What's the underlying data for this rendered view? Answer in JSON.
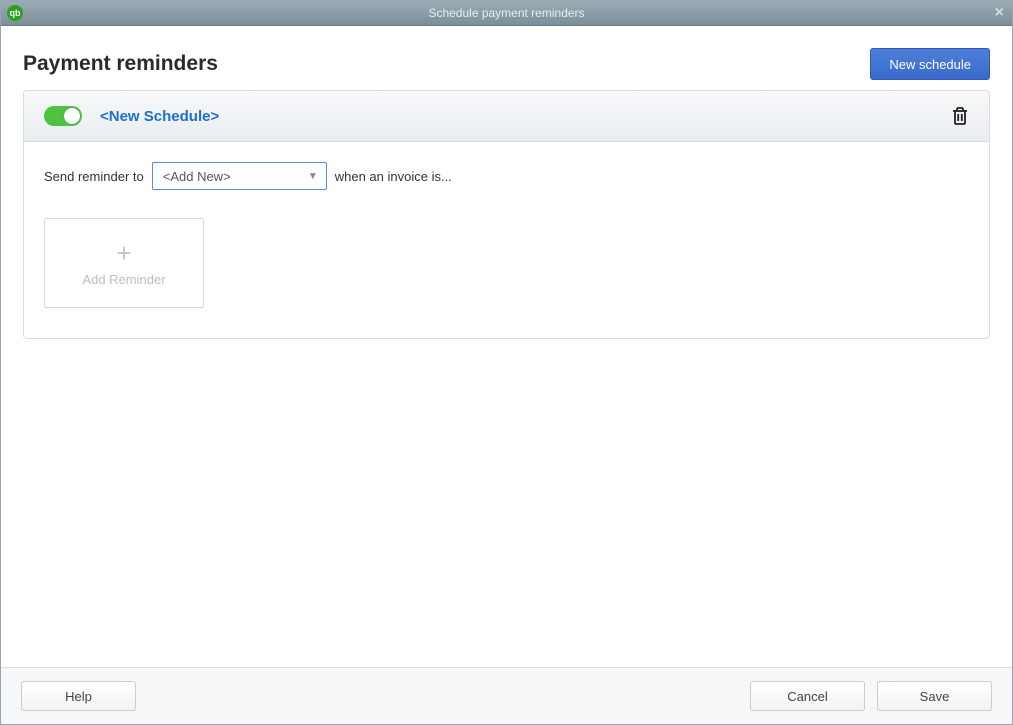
{
  "window": {
    "title": "Schedule payment reminders"
  },
  "header": {
    "page_title": "Payment reminders",
    "new_schedule_label": "New schedule"
  },
  "schedule": {
    "name": "<New Schedule>",
    "enabled": true,
    "send_reminder_prefix": "Send reminder to",
    "recipient_select_value": "<Add New>",
    "send_reminder_suffix": "when an invoice is...",
    "add_reminder_label": "Add Reminder"
  },
  "footer": {
    "help_label": "Help",
    "cancel_label": "Cancel",
    "save_label": "Save"
  }
}
